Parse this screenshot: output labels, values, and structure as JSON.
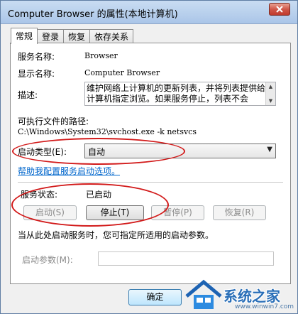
{
  "window": {
    "title": "Computer Browser 的属性(本地计算机)"
  },
  "tabs": [
    {
      "label": "常规"
    },
    {
      "label": "登录"
    },
    {
      "label": "恢复"
    },
    {
      "label": "依存关系"
    }
  ],
  "general": {
    "service_name_label": "服务名称:",
    "service_name_value": "Browser",
    "display_name_label": "显示名称:",
    "display_name_value": "Computer Browser",
    "description_label": "描述:",
    "description_value": "维护网络上计算机的更新列表，并将列表提供给计算机指定浏览。如果服务停止，列表不会",
    "exe_path_label": "可执行文件的路径:",
    "exe_path_value": "C:\\Windows\\System32\\svchost.exe -k netsvcs",
    "startup_type_label": "启动类型(E):",
    "startup_type_value": "自动",
    "help_link": "帮助我配置服务启动选项。",
    "service_status_label": "服务状态:",
    "service_status_value": "已启动",
    "start_button": "启动(S)",
    "stop_button": "停止(T)",
    "pause_button": "暂停(P)",
    "resume_button": "恢复(R)",
    "start_hint": "当从此处启动服务时，您可指定所适用的启动参数。",
    "start_params_label": "启动参数(M):",
    "start_params_value": ""
  },
  "footer": {
    "ok_button": "确定"
  },
  "watermark": {
    "text": "系统之家",
    "url": "www.winwin7.com"
  },
  "colors": {
    "annotation": "#d21a1a",
    "link": "#0066cc",
    "watermark": "#2a6fb8"
  }
}
